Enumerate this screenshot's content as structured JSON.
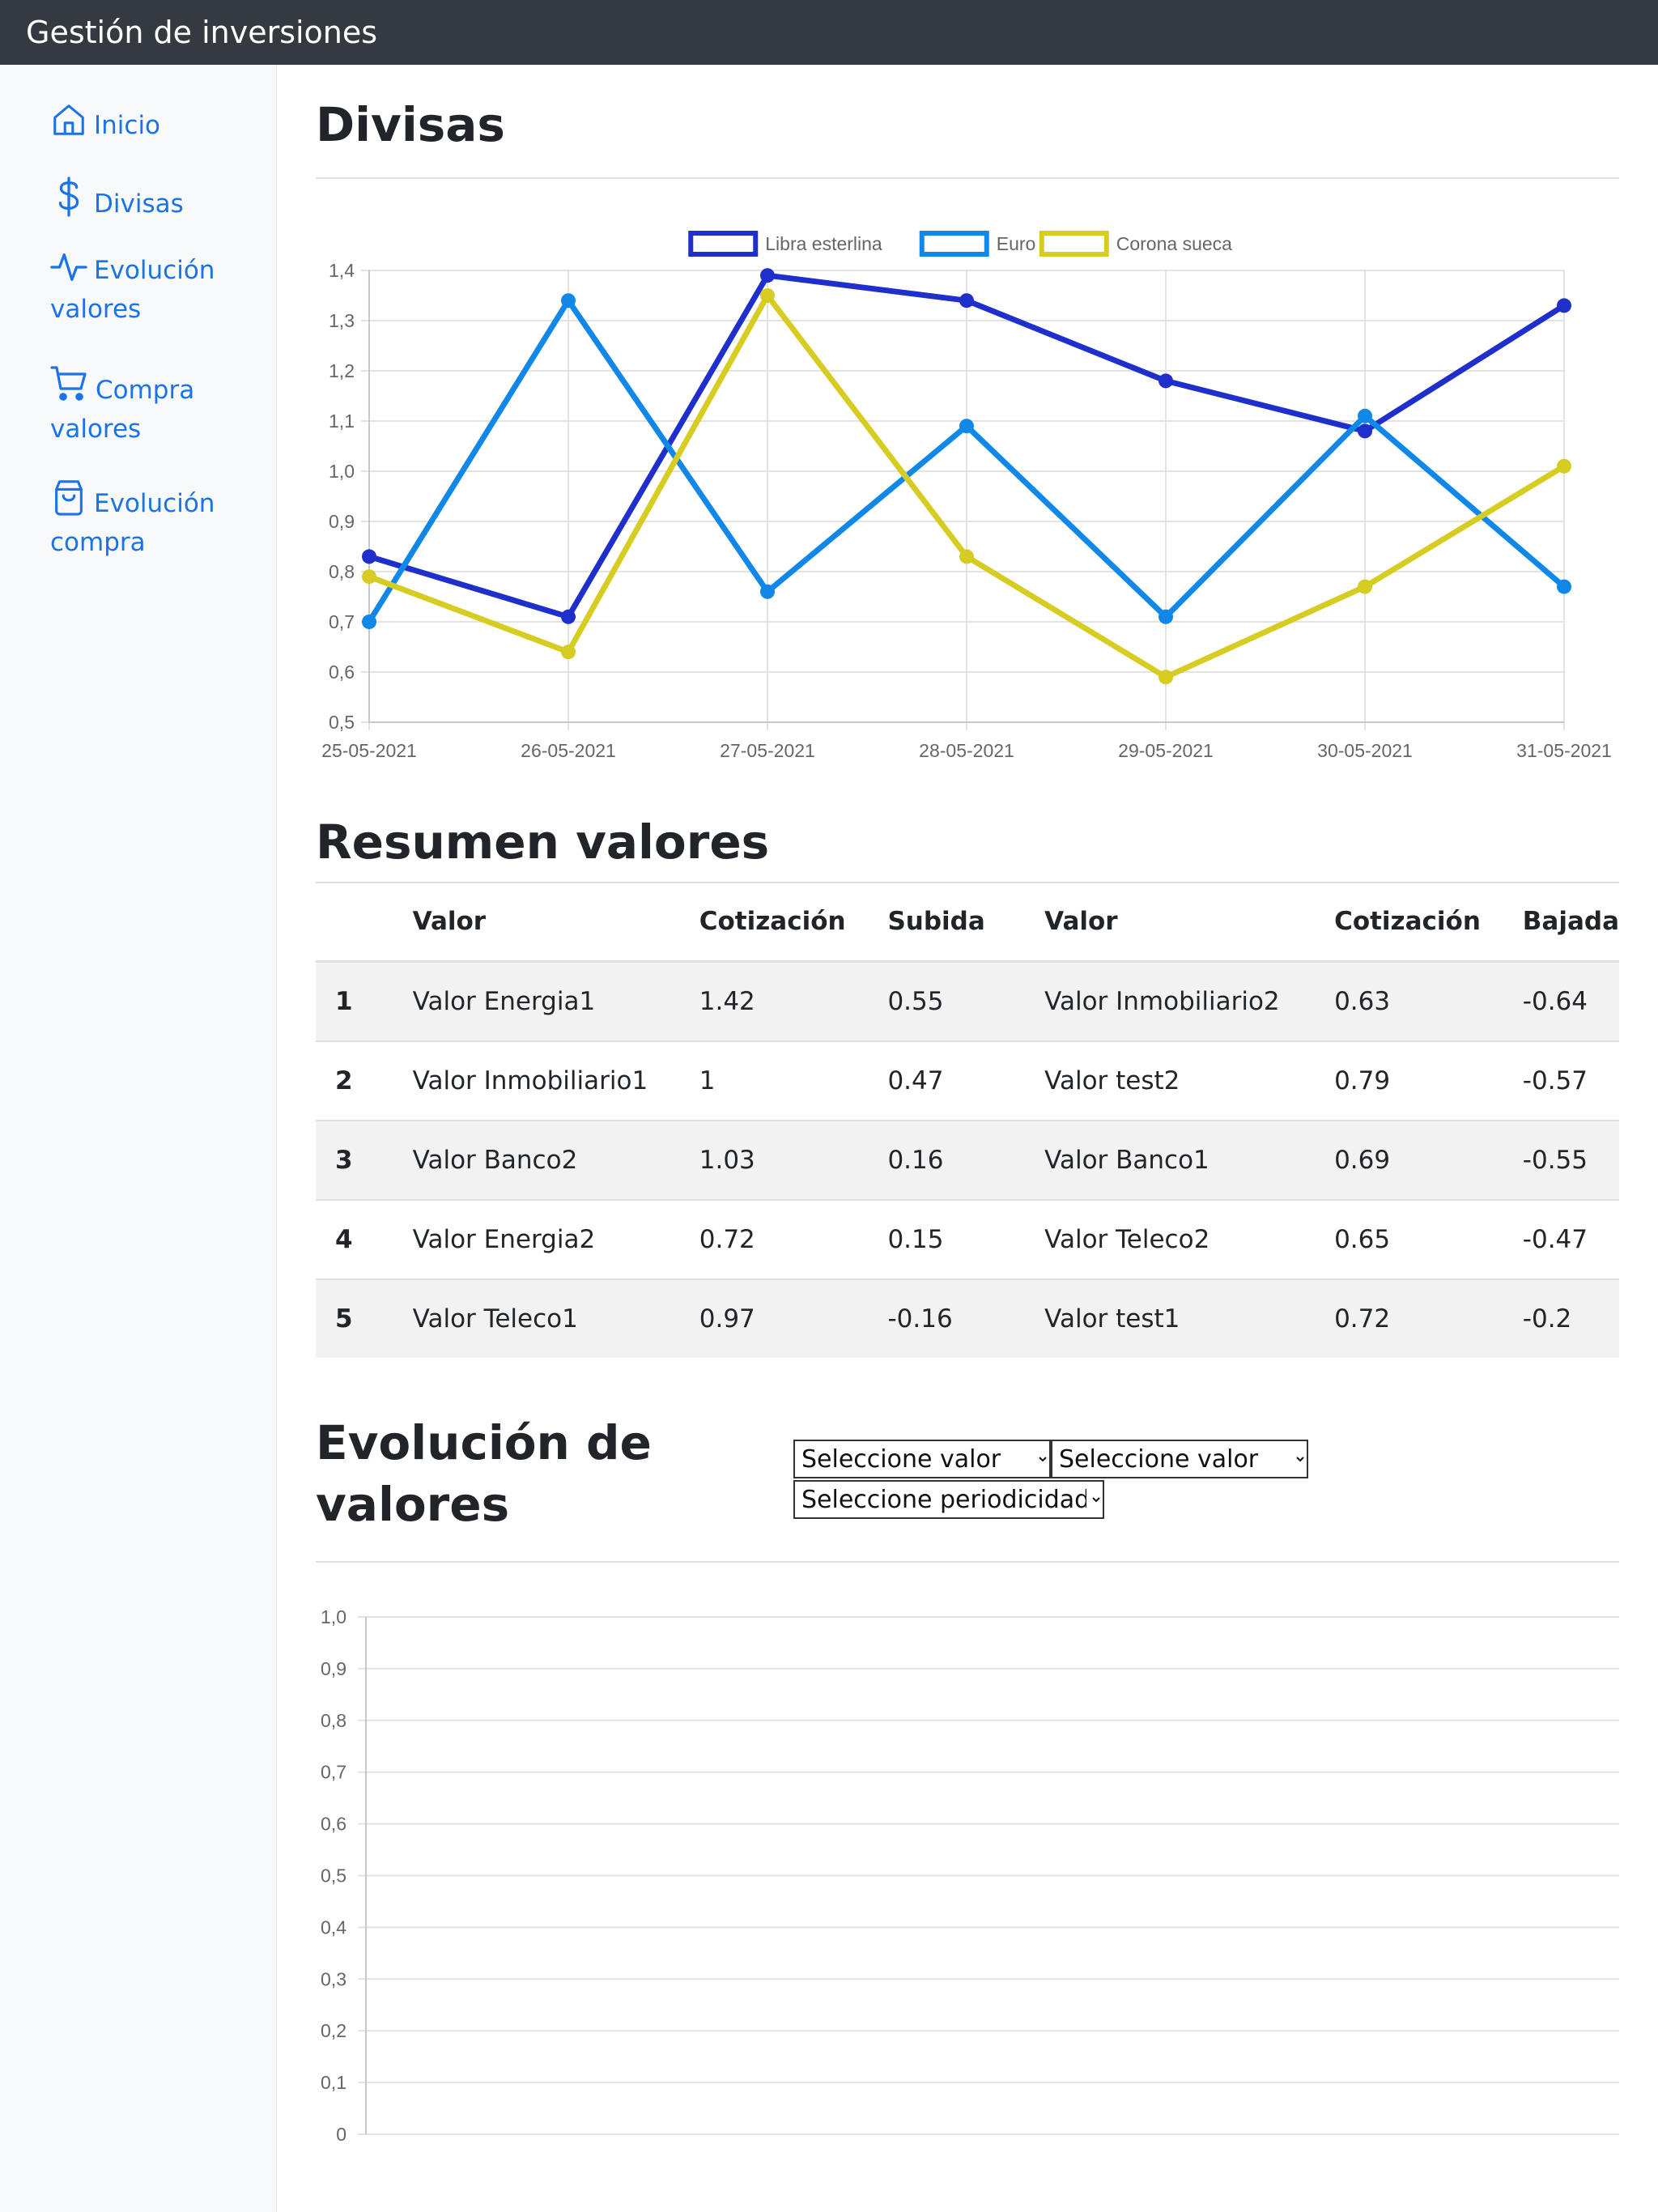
{
  "app": {
    "title": "Gestión de inversiones"
  },
  "sidebar": {
    "items": [
      {
        "label": "Inicio",
        "icon": "house-icon"
      },
      {
        "label": "Divisas",
        "icon": "dollar-icon"
      },
      {
        "label": "Evolución valores",
        "icon": "activity-icon"
      },
      {
        "label": "Compra valores",
        "icon": "cart-icon"
      },
      {
        "label": "Evolución compra",
        "icon": "bag-icon"
      }
    ],
    "accent_color": "#1a73e8"
  },
  "divisas": {
    "title": "Divisas"
  },
  "resumen": {
    "title": "Resumen valores",
    "headers": [
      "",
      "Valor",
      "Cotización",
      "Subida",
      "Valor",
      "Cotización",
      "Bajada"
    ],
    "rows": [
      [
        "1",
        "Valor Energia1",
        "1.42",
        "0.55",
        "Valor Inmobiliario2",
        "0.63",
        "-0.64"
      ],
      [
        "2",
        "Valor Inmobiliario1",
        "1",
        "0.47",
        "Valor test2",
        "0.79",
        "-0.57"
      ],
      [
        "3",
        "Valor Banco2",
        "1.03",
        "0.16",
        "Valor Banco1",
        "0.69",
        "-0.55"
      ],
      [
        "4",
        "Valor Energia2",
        "0.72",
        "0.15",
        "Valor Teleco2",
        "0.65",
        "-0.47"
      ],
      [
        "5",
        "Valor Teleco1",
        "0.97",
        "-0.16",
        "Valor test1",
        "0.72",
        "-0.2"
      ]
    ]
  },
  "evolucion": {
    "title": "Evolución de valores",
    "select_valor_1": "Seleccione valor",
    "select_valor_2": "Seleccione valor",
    "select_periodicidad": "Seleccione periodicidad"
  },
  "chart_data": [
    {
      "type": "line",
      "x": [
        "25-05-2021",
        "26-05-2021",
        "27-05-2021",
        "28-05-2021",
        "29-05-2021",
        "30-05-2021",
        "31-05-2021"
      ],
      "series": [
        {
          "name": "Libra esterlina",
          "color": "#1f2fcc",
          "values": [
            0.83,
            0.71,
            1.39,
            1.34,
            1.18,
            1.08,
            1.33
          ]
        },
        {
          "name": "Euro",
          "color": "#1188e8",
          "values": [
            0.7,
            1.34,
            0.76,
            1.09,
            0.71,
            1.11,
            0.77
          ]
        },
        {
          "name": "Corona sueca",
          "color": "#d6cc22",
          "values": [
            0.79,
            0.64,
            1.35,
            0.83,
            0.59,
            0.77,
            1.01
          ]
        }
      ],
      "ylim": [
        0.5,
        1.4
      ],
      "yticks": [
        "0,5",
        "0,6",
        "0,7",
        "0,8",
        "0,9",
        "1,0",
        "1,1",
        "1,2",
        "1,3",
        "1,4"
      ],
      "legend": "top",
      "grid": true
    },
    {
      "type": "line",
      "x": [],
      "series": [],
      "ylim": [
        0,
        1.0
      ],
      "yticks": [
        "0",
        "0,1",
        "0,2",
        "0,3",
        "0,4",
        "0,5",
        "0,6",
        "0,7",
        "0,8",
        "0,9",
        "1,0"
      ],
      "grid": true
    }
  ]
}
